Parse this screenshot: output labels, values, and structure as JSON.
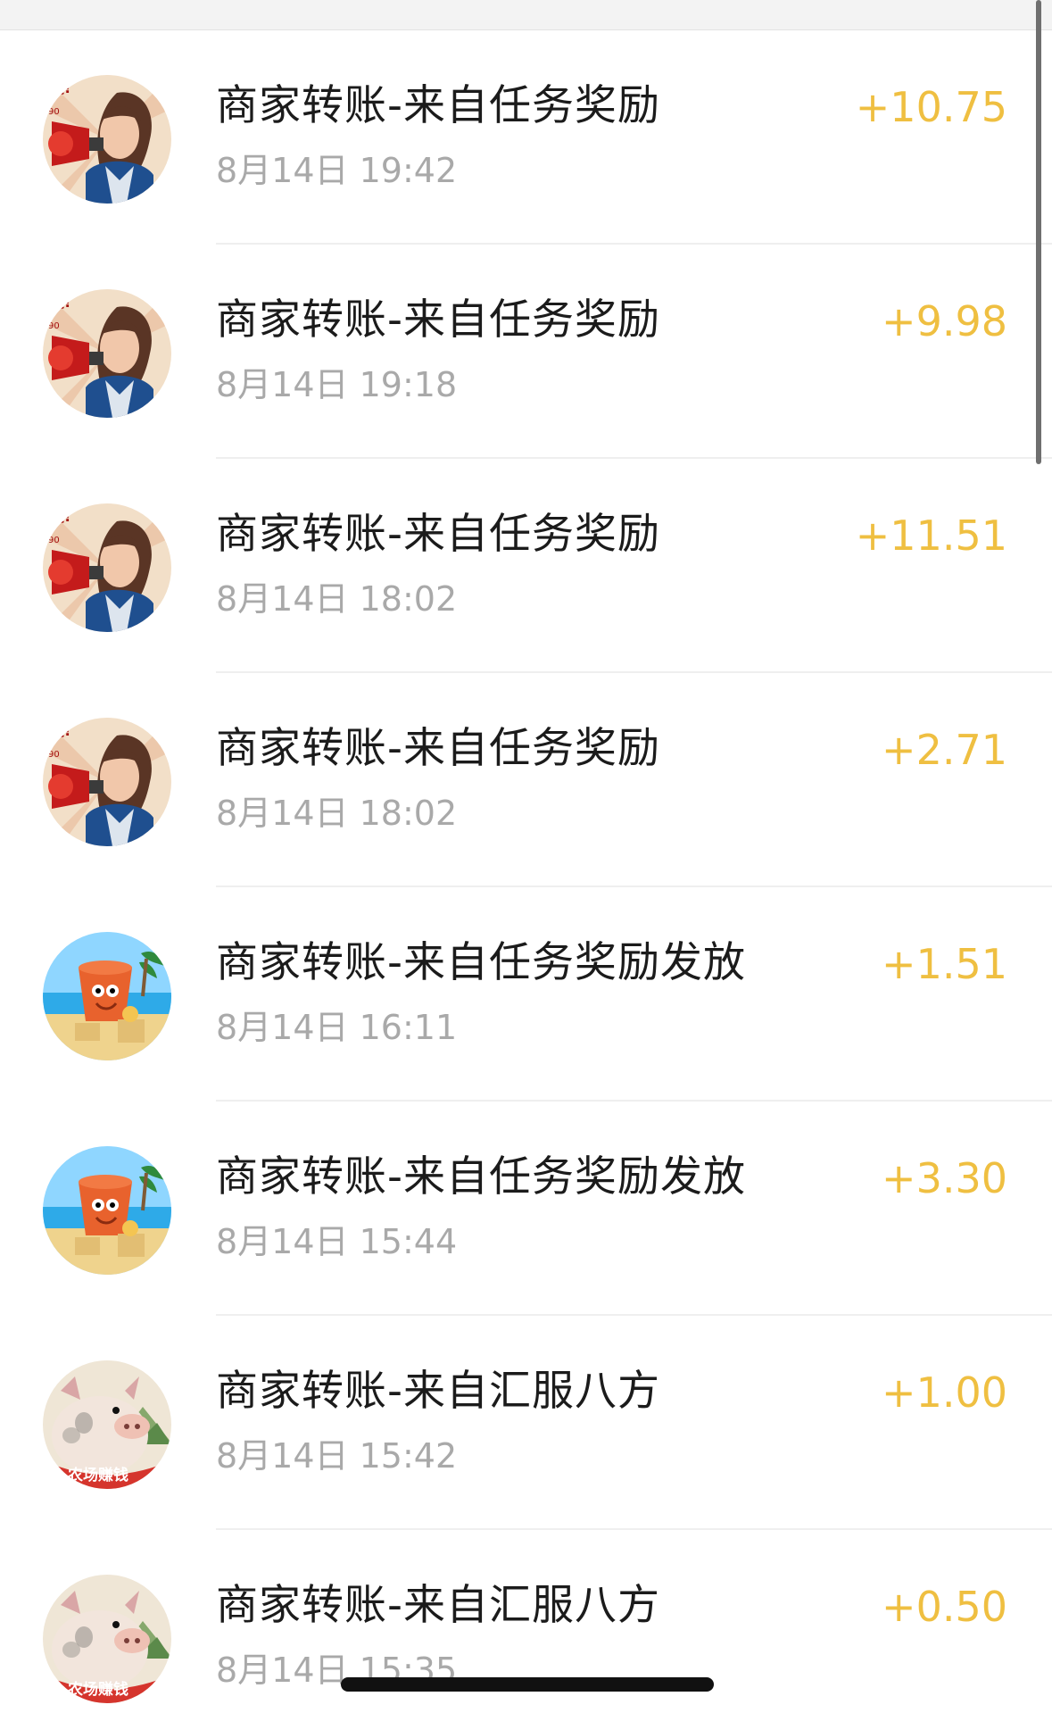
{
  "transactions": [
    {
      "title": "商家转账-来自任务奖励",
      "time": "8月14日 19:42",
      "amount": "+10.75",
      "avatar_icon": "announcer-woman-avatar-icon"
    },
    {
      "title": "商家转账-来自任务奖励",
      "time": "8月14日 19:18",
      "amount": "+9.98",
      "avatar_icon": "announcer-woman-avatar-icon"
    },
    {
      "title": "商家转账-来自任务奖励",
      "time": "8月14日 18:02",
      "amount": "+11.51",
      "avatar_icon": "announcer-woman-avatar-icon"
    },
    {
      "title": "商家转账-来自任务奖励",
      "time": "8月14日 18:02",
      "amount": "+2.71",
      "avatar_icon": "announcer-woman-avatar-icon"
    },
    {
      "title": "商家转账-来自任务奖励发放",
      "time": "8月14日 16:11",
      "amount": "+1.51",
      "avatar_icon": "beach-bucket-avatar-icon"
    },
    {
      "title": "商家转账-来自任务奖励发放",
      "time": "8月14日 15:44",
      "amount": "+3.30",
      "avatar_icon": "beach-bucket-avatar-icon"
    },
    {
      "title": "商家转账-来自汇服八方",
      "time": "8月14日 15:42",
      "amount": "+1.00",
      "avatar_icon": "farm-pig-avatar-icon",
      "avatar_badge": "农场赚钱"
    },
    {
      "title": "商家转账-来自汇服八方",
      "time": "8月14日 15:35",
      "amount": "+0.50",
      "avatar_icon": "farm-pig-avatar-icon",
      "avatar_badge": "农场赚钱"
    }
  ],
  "colors": {
    "amount": "#efbf41",
    "title": "#1b1b1b",
    "time": "#a9a9a9",
    "divider": "#efefef"
  }
}
